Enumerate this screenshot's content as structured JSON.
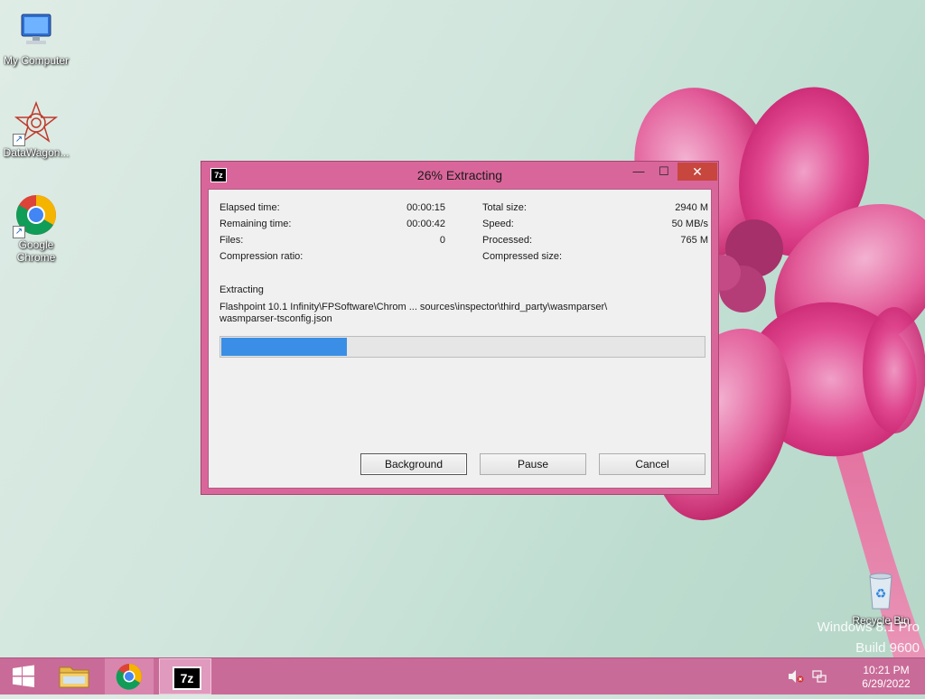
{
  "desktop": {
    "icons": [
      {
        "label": "My Computer",
        "icon": "computer-icon"
      },
      {
        "label": "DataWagon...",
        "icon": "datawagon-icon"
      },
      {
        "label": "Google\nChrome",
        "icon": "chrome-icon"
      },
      {
        "label": "Recycle Bin",
        "icon": "recycle-bin-icon"
      }
    ],
    "watermark": {
      "line1": "Windows 8.1 Pro",
      "line2": "Build 9600"
    }
  },
  "dialog": {
    "app_icon": "7z",
    "title": "26% Extracting",
    "controls": {
      "minimize": "—",
      "maximize": "☐",
      "close": "✕"
    },
    "stats_left": [
      {
        "label": "Elapsed time:",
        "value": "00:00:15"
      },
      {
        "label": "Remaining time:",
        "value": "00:00:42"
      },
      {
        "label": "Files:",
        "value": "0"
      },
      {
        "label": "Compression ratio:",
        "value": ""
      }
    ],
    "stats_right": [
      {
        "label": "Total size:",
        "value": "2940 M"
      },
      {
        "label": "Speed:",
        "value": "50 MB/s"
      },
      {
        "label": "Processed:",
        "value": "765 M"
      },
      {
        "label": "Compressed size:",
        "value": ""
      }
    ],
    "operation": "Extracting",
    "path_line1": "Flashpoint 10.1 Infinity\\FPSoftware\\Chrom ... sources\\inspector\\third_party\\wasmparser\\",
    "path_line2": "wasmparser-tsconfig.json",
    "progress": 0.26,
    "buttons": {
      "background": "Background",
      "pause": "Pause",
      "cancel": "Cancel"
    }
  },
  "taskbar": {
    "sevenzip_label": "7z",
    "time": "10:21 PM",
    "date": "6/29/2022"
  },
  "colors": {
    "accent": "#d9669a",
    "progress": "#3a8ee6",
    "close": "#c7463e"
  }
}
